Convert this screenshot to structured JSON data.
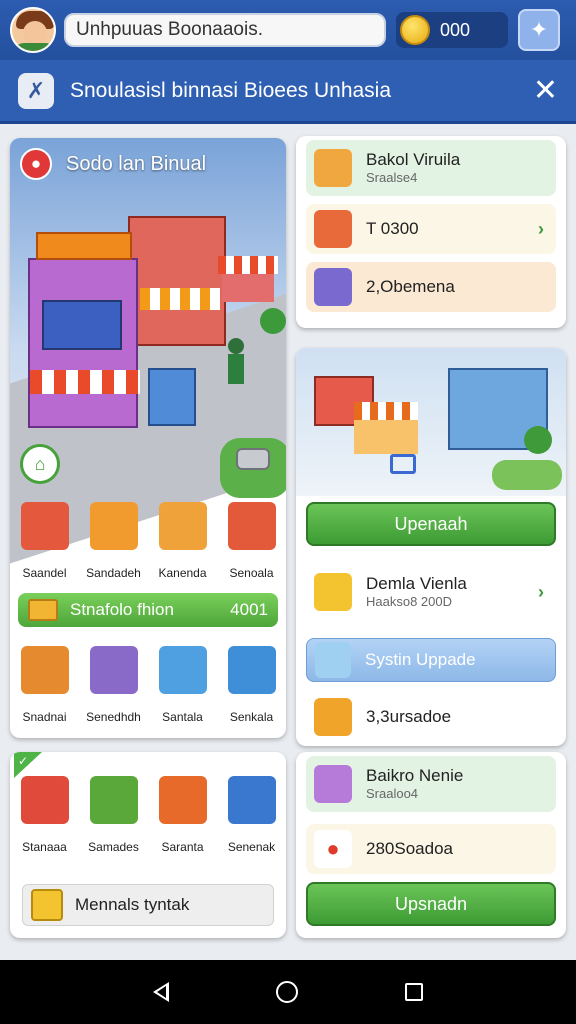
{
  "header": {
    "search_text": "Unhpuuas Boonaaois.",
    "coins": "000"
  },
  "titlebar": {
    "title": "Snoulasisl binnasi Bioees Unhasia"
  },
  "shop_card": {
    "title": "Sodo lan Binual",
    "row1": [
      {
        "label": "Saandel",
        "icon": "market-stall-icon",
        "color": "#e4583e"
      },
      {
        "label": "Sandadeh",
        "icon": "awning-stall-icon",
        "color": "#f19a2e"
      },
      {
        "label": "Kanenda",
        "icon": "vending-box-icon",
        "color": "#f0a23a"
      },
      {
        "label": "Senoala",
        "icon": "shopping-cart-icon",
        "color": "#e35a3a"
      }
    ],
    "bar": {
      "label": "Stnafolo fhion",
      "value": "4001"
    },
    "row2": [
      {
        "label": "Snadnai",
        "icon": "crate-icon",
        "color": "#e58a2e"
      },
      {
        "label": "Senedhdh",
        "icon": "shopkeeper-icon",
        "color": "#8a6ac8"
      },
      {
        "label": "Santala",
        "icon": "cart-icon",
        "color": "#4fa0e0"
      },
      {
        "label": "Senkala",
        "icon": "display-cart-icon",
        "color": "#3f8fd8"
      }
    ]
  },
  "items_card": {
    "row": [
      {
        "label": "Stanaaa",
        "icon": "stall-icon",
        "color": "#e04a3a"
      },
      {
        "label": "Samades",
        "icon": "planter-icon",
        "color": "#5aa83a"
      },
      {
        "label": "Saranta",
        "icon": "lamp-icon",
        "color": "#e86a2a"
      },
      {
        "label": "Senenak",
        "icon": "basket-cart-icon",
        "color": "#3a78d0"
      }
    ],
    "menu_label": "Mennals tyntak"
  },
  "right_top": {
    "item1_title": "Bakol Viruila",
    "item1_sub": "Sraalse4",
    "item2_text": "T 0300",
    "item3_text": "2,Obemena"
  },
  "right_mid": {
    "upgrade_label": "Upenaah",
    "item_title": "Demla Vienla",
    "item_sub": "Haakso8 200D",
    "system_label": "Systin Uppade",
    "value_text": "3,3ursadoe"
  },
  "right_bottom": {
    "item_title": "Baikro Nenie",
    "item_sub": "Sraaloo4",
    "value_text": "280Soadoa",
    "upgrade_label": "Upsnadn"
  },
  "colors": {
    "primary_blue": "#2f5fb3",
    "accent_green": "#4ea53a",
    "coin_gold": "#e6a912"
  }
}
